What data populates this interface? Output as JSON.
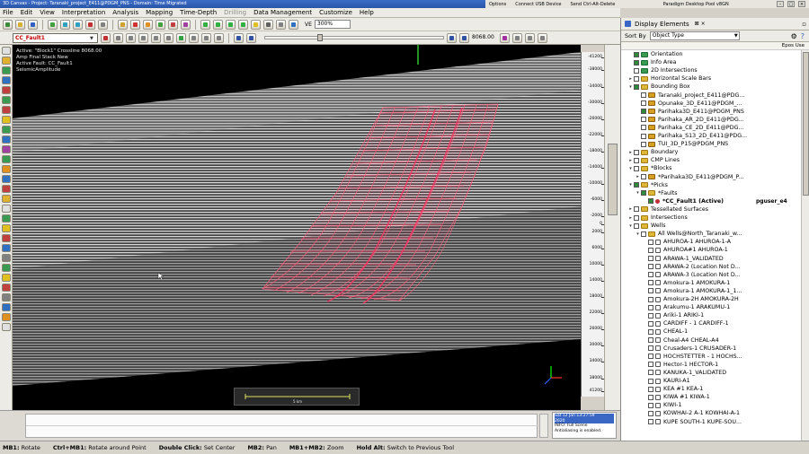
{
  "window": {
    "title": "3D Canvas - Project: Taranaki_project_E411@PDGM_PNS - Domain: Time Migrated",
    "right_title": "Paradigm Desktop Pool v8GN",
    "top_actions": [
      "Options",
      "Connect USB Device",
      "Send Ctrl-Alt-Delete"
    ]
  },
  "menu": [
    "File",
    "Edit",
    "View",
    "Interpretation",
    "Analysis",
    "Mapping",
    "Time-Depth",
    "Drilling",
    "Data Management",
    "Customize",
    "Help"
  ],
  "toolbar": {
    "ve_label": "VE",
    "zoom_value": "300%"
  },
  "toolbar2": {
    "active_fault": "CC_Fault1",
    "crossline_value": "8068.00"
  },
  "overlay": {
    "line1": "Active: \"Block1\" Crossline 8068.00",
    "line2": "Amp Final Stack New",
    "line3": "Active Fault: CC_Fault1",
    "line4": "SeismicAmplitude"
  },
  "depth_scale": {
    "ticks": [
      -41200,
      -38000,
      -34000,
      -30000,
      -26000,
      -22000,
      -18000,
      -14000,
      -10000,
      -6000,
      -2000,
      0,
      2000,
      6000,
      10000,
      14000,
      18000,
      22000,
      26000,
      30000,
      34000,
      38000,
      41200
    ],
    "labels": [
      "-41200",
      "-38000",
      "-34000",
      "-30000",
      "-26000",
      "-22000",
      "-18000",
      "-14000",
      "-10000",
      "-6000",
      "-2000",
      "0",
      "2000",
      "6000",
      "10000",
      "14000",
      "18000",
      "22000",
      "26000",
      "30000",
      "34000",
      "38000",
      "41200"
    ]
  },
  "scalebar_label": "5 km",
  "info_panel": {
    "line1": "Sat 12 Jan 13:27:59",
    "line2": "2020",
    "line3": "INFO:  Full Scene",
    "line4": "Antialiasing is enabled."
  },
  "hints": [
    {
      "key": "MB1:",
      "text": "Rotate"
    },
    {
      "key": "Ctrl+MB1:",
      "text": "Rotate around Point"
    },
    {
      "key": "Double Click:",
      "text": "Set Center"
    },
    {
      "key": "MB2:",
      "text": "Pan"
    },
    {
      "key": "MB1+MB2:",
      "text": "Zoom"
    },
    {
      "key": "Hold Alt:",
      "text": "Switch to Previous Tool"
    }
  ],
  "panel": {
    "title": "Display Elements",
    "sort_label": "Sort By",
    "sort_value": "Object Type",
    "col_right": "Epos Use",
    "items": [
      {
        "label": "Orientation",
        "indent": 0,
        "exp": "",
        "checked": true,
        "icon": "green"
      },
      {
        "label": "Info Area",
        "indent": 0,
        "exp": "",
        "checked": true,
        "icon": "green"
      },
      {
        "label": "2D Intersections",
        "indent": 0,
        "exp": "",
        "checked": false,
        "icon": "green"
      },
      {
        "label": "Horizontal Scale Bars",
        "indent": 0,
        "exp": "▸",
        "checked": false,
        "icon": "folder"
      },
      {
        "label": "Bounding Box",
        "indent": 0,
        "exp": "▾",
        "checked": true,
        "icon": "folder"
      },
      {
        "label": "Taranaki_project_E411@PDG...",
        "indent": 1,
        "exp": "",
        "checked": false,
        "icon": "survey"
      },
      {
        "label": "Opunake_3D_E411@PDGM_...",
        "indent": 1,
        "exp": "",
        "checked": false,
        "icon": "survey"
      },
      {
        "label": "Parihaka3D_E411@PDGM_PNS",
        "indent": 1,
        "exp": "",
        "checked": true,
        "icon": "survey"
      },
      {
        "label": "Parihaka_AR_2D_E411@PDG...",
        "indent": 1,
        "exp": "",
        "checked": false,
        "icon": "survey"
      },
      {
        "label": "Parihaka_CE_2D_E411@PDG...",
        "indent": 1,
        "exp": "",
        "checked": false,
        "icon": "survey"
      },
      {
        "label": "Parihaka_S13_2D_E411@PDG...",
        "indent": 1,
        "exp": "",
        "checked": false,
        "icon": "survey"
      },
      {
        "label": "TUI_3D_P15@PDGM_PNS",
        "indent": 1,
        "exp": "",
        "checked": false,
        "icon": "survey"
      },
      {
        "label": "Boundary",
        "indent": 0,
        "exp": "▸",
        "checked": false,
        "icon": "folder"
      },
      {
        "label": "CMP Lines",
        "indent": 0,
        "exp": "▸",
        "checked": false,
        "icon": "folder"
      },
      {
        "label": "*Blocks",
        "indent": 0,
        "exp": "▾",
        "checked": false,
        "icon": "folder"
      },
      {
        "label": "*Parihaka3D_E411@PDGM_P...",
        "indent": 1,
        "exp": "▸",
        "checked": false,
        "icon": "survey"
      },
      {
        "label": "*Picks",
        "indent": 0,
        "exp": "▾",
        "checked": true,
        "icon": "folder"
      },
      {
        "label": "*Faults",
        "indent": 1,
        "exp": "▾",
        "checked": true,
        "icon": "folder"
      },
      {
        "label": "*CC_Fault1 (Active)",
        "indent": 2,
        "exp": "",
        "checked": true,
        "icon": "fault",
        "owner": "pguser_e4",
        "active": true
      },
      {
        "label": "Tessellated Surfaces",
        "indent": 0,
        "exp": "▸",
        "checked": false,
        "icon": "folder"
      },
      {
        "label": "Intersections",
        "indent": 0,
        "exp": "▸",
        "checked": false,
        "icon": "folder"
      },
      {
        "label": "Wells",
        "indent": 0,
        "exp": "▾",
        "checked": false,
        "icon": "folder"
      },
      {
        "label": "All Wells@North_Taranaki_w...",
        "indent": 1,
        "exp": "▾",
        "checked": false,
        "icon": "folder"
      },
      {
        "label": "AHUROA-1 AHUROA-1-A",
        "indent": 2,
        "exp": "",
        "checked": false,
        "icon": "well"
      },
      {
        "label": "AHUROA#1 AHUROA-1",
        "indent": 2,
        "exp": "",
        "checked": false,
        "icon": "well"
      },
      {
        "label": "ARAWA-1_VALIDATED",
        "indent": 2,
        "exp": "",
        "checked": false,
        "icon": "well"
      },
      {
        "label": "ARAWA-2 (Location Not D...",
        "indent": 2,
        "exp": "",
        "checked": false,
        "icon": "well"
      },
      {
        "label": "ARAWA-3 (Location Not D...",
        "indent": 2,
        "exp": "",
        "checked": false,
        "icon": "well"
      },
      {
        "label": "Amokura-1 AMOKURA-1",
        "indent": 2,
        "exp": "",
        "checked": false,
        "icon": "well"
      },
      {
        "label": "Amokura-1 AMOKURA-1_1...",
        "indent": 2,
        "exp": "",
        "checked": false,
        "icon": "well"
      },
      {
        "label": "Amokura-2H AMOKURA-2H",
        "indent": 2,
        "exp": "",
        "checked": false,
        "icon": "well"
      },
      {
        "label": "Arakumu-1 ARAKUMU-1",
        "indent": 2,
        "exp": "",
        "checked": false,
        "icon": "well"
      },
      {
        "label": "Ariki-1 ARIKI-1",
        "indent": 2,
        "exp": "",
        "checked": false,
        "icon": "well"
      },
      {
        "label": "CARDIFF - 1 CARDIFF-1",
        "indent": 2,
        "exp": "",
        "checked": false,
        "icon": "well"
      },
      {
        "label": "CHEAL-1",
        "indent": 2,
        "exp": "",
        "checked": false,
        "icon": "well"
      },
      {
        "label": "Cheal-A4 CHEAL-A4",
        "indent": 2,
        "exp": "",
        "checked": false,
        "icon": "well"
      },
      {
        "label": "Crusaders-1 CRUSADER-1",
        "indent": 2,
        "exp": "",
        "checked": false,
        "icon": "well"
      },
      {
        "label": "HOCHSTETTER - 1 HOCHS...",
        "indent": 2,
        "exp": "",
        "checked": false,
        "icon": "well"
      },
      {
        "label": "Hector-1 HECTOR-1",
        "indent": 2,
        "exp": "",
        "checked": false,
        "icon": "well"
      },
      {
        "label": "KANUKA-1_VALIDATED",
        "indent": 2,
        "exp": "",
        "checked": false,
        "icon": "well"
      },
      {
        "label": "KAURI-A1",
        "indent": 2,
        "exp": "",
        "checked": false,
        "icon": "well"
      },
      {
        "label": "KEA #1 KEA-1",
        "indent": 2,
        "exp": "",
        "checked": false,
        "icon": "well"
      },
      {
        "label": "KIWA #1 KIWA-1",
        "indent": 2,
        "exp": "",
        "checked": false,
        "icon": "well"
      },
      {
        "label": "KIWI-1",
        "indent": 2,
        "exp": "",
        "checked": false,
        "icon": "well"
      },
      {
        "label": "KOWHAI-2 A-1 KOWHAI-A-1",
        "indent": 2,
        "exp": "",
        "checked": false,
        "icon": "well"
      },
      {
        "label": "KUPE SOUTH-1 KUPE-SOU...",
        "indent": 2,
        "exp": "",
        "checked": false,
        "icon": "well"
      }
    ]
  }
}
